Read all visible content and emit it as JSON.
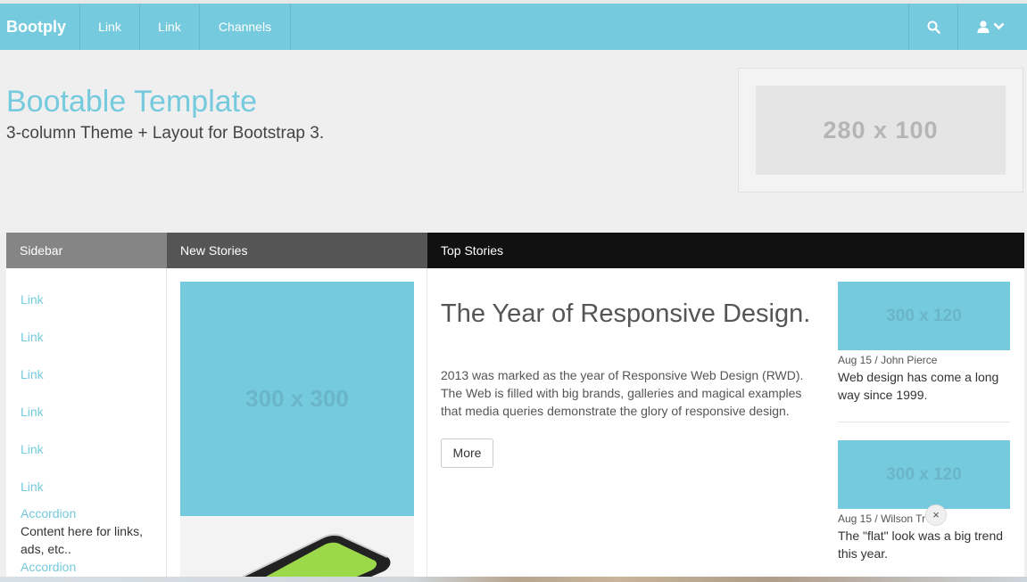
{
  "navbar": {
    "brand": "Bootply",
    "links": [
      "Link",
      "Link",
      "Channels"
    ],
    "search_icon": "search-icon",
    "user_icon": "user-icon",
    "chevron_icon": "chevron-down-icon",
    "color": "#75cadd"
  },
  "header": {
    "title": "Bootable Template",
    "subtitle": "3-column Theme + Layout for Bootstrap 3.",
    "ad_placeholder": "280 x 100"
  },
  "columns": {
    "sidebar": "Sidebar",
    "new_stories": "New Stories",
    "top_stories": "Top Stories"
  },
  "sidebar": {
    "links": [
      "Link",
      "Link",
      "Link",
      "Link",
      "Link",
      "Link"
    ],
    "accordion_1": "Accordion",
    "accordion_text": "Content here for links, ads, etc..",
    "accordion_2": "Accordion"
  },
  "new_stories": {
    "placeholder": "300 x 300"
  },
  "main_story": {
    "title": "The Year of Responsive Design.",
    "body": "2013 was marked as the year of Responsive Web Design (RWD). The Web is filled with big brands, galleries and magical examples that media queries demonstrate the glory of responsive design.",
    "button": "More"
  },
  "top_stories": [
    {
      "placeholder": "300 x 120",
      "date": "Aug 15",
      "author": "John Pierce",
      "blurb": "Web design has come a long way since 1999."
    },
    {
      "placeholder": "300 x 120",
      "date": "Aug 15",
      "author": "Wilson Tr",
      "author_tail": "er",
      "blurb": "The \"flat\" look was a big trend this year."
    }
  ],
  "close_badge": "×",
  "colors": {
    "accent": "#75cadd",
    "sidebar_head": "#858585",
    "new_head": "#555555",
    "top_head": "#111111"
  }
}
